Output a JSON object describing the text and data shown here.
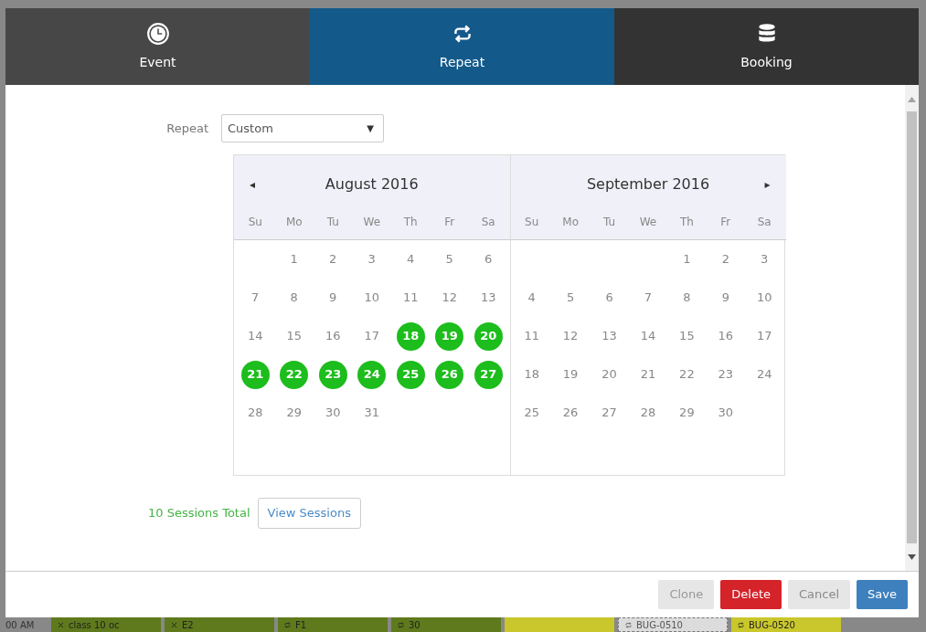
{
  "tabs": [
    {
      "label": "Event",
      "selected": false
    },
    {
      "label": "Repeat",
      "selected": true
    },
    {
      "label": "Booking",
      "selected": false
    }
  ],
  "repeat": {
    "label": "Repeat",
    "value": "Custom",
    "caret": "▼"
  },
  "calendar": {
    "prev": "◂",
    "next": "▸",
    "months": [
      {
        "title": "August 2016",
        "weekdays": [
          "Su",
          "Mo",
          "Tu",
          "We",
          "Th",
          "Fr",
          "Sa"
        ],
        "weeks": [
          [
            {
              "kind": "blank"
            },
            {
              "kind": "day",
              "day": "1",
              "selected": false
            },
            {
              "kind": "day",
              "day": "2",
              "selected": false
            },
            {
              "kind": "day",
              "day": "3",
              "selected": false
            },
            {
              "kind": "day",
              "day": "4",
              "selected": false
            },
            {
              "kind": "day",
              "day": "5",
              "selected": false
            },
            {
              "kind": "day",
              "day": "6",
              "selected": false
            }
          ],
          [
            {
              "kind": "day",
              "day": "7",
              "selected": false
            },
            {
              "kind": "day",
              "day": "8",
              "selected": false
            },
            {
              "kind": "day",
              "day": "9",
              "selected": false
            },
            {
              "kind": "day",
              "day": "10",
              "selected": false
            },
            {
              "kind": "day",
              "day": "11",
              "selected": false
            },
            {
              "kind": "day",
              "day": "12",
              "selected": false
            },
            {
              "kind": "day",
              "day": "13",
              "selected": false
            }
          ],
          [
            {
              "kind": "day",
              "day": "14",
              "selected": false
            },
            {
              "kind": "day",
              "day": "15",
              "selected": false
            },
            {
              "kind": "day",
              "day": "16",
              "selected": false
            },
            {
              "kind": "day",
              "day": "17",
              "selected": false
            },
            {
              "kind": "day",
              "day": "18",
              "selected": true
            },
            {
              "kind": "day",
              "day": "19",
              "selected": true
            },
            {
              "kind": "day",
              "day": "20",
              "selected": true
            }
          ],
          [
            {
              "kind": "day",
              "day": "21",
              "selected": true
            },
            {
              "kind": "day",
              "day": "22",
              "selected": true
            },
            {
              "kind": "day",
              "day": "23",
              "selected": true
            },
            {
              "kind": "day",
              "day": "24",
              "selected": true
            },
            {
              "kind": "day",
              "day": "25",
              "selected": true
            },
            {
              "kind": "day",
              "day": "26",
              "selected": true
            },
            {
              "kind": "day",
              "day": "27",
              "selected": true
            }
          ],
          [
            {
              "kind": "day",
              "day": "28",
              "selected": false
            },
            {
              "kind": "day",
              "day": "29",
              "selected": false
            },
            {
              "kind": "day",
              "day": "30",
              "selected": false
            },
            {
              "kind": "day",
              "day": "31",
              "selected": false
            },
            {
              "kind": "blank"
            },
            {
              "kind": "blank"
            },
            {
              "kind": "blank"
            }
          ]
        ]
      },
      {
        "title": "September 2016",
        "weekdays": [
          "Su",
          "Mo",
          "Tu",
          "We",
          "Th",
          "Fr",
          "Sa"
        ],
        "weeks": [
          [
            {
              "kind": "blank"
            },
            {
              "kind": "blank"
            },
            {
              "kind": "blank"
            },
            {
              "kind": "blank"
            },
            {
              "kind": "day",
              "day": "1",
              "selected": false
            },
            {
              "kind": "day",
              "day": "2",
              "selected": false
            },
            {
              "kind": "day",
              "day": "3",
              "selected": false
            }
          ],
          [
            {
              "kind": "day",
              "day": "4",
              "selected": false
            },
            {
              "kind": "day",
              "day": "5",
              "selected": false
            },
            {
              "kind": "day",
              "day": "6",
              "selected": false
            },
            {
              "kind": "day",
              "day": "7",
              "selected": false
            },
            {
              "kind": "day",
              "day": "8",
              "selected": false
            },
            {
              "kind": "day",
              "day": "9",
              "selected": false
            },
            {
              "kind": "day",
              "day": "10",
              "selected": false
            }
          ],
          [
            {
              "kind": "day",
              "day": "11",
              "selected": false
            },
            {
              "kind": "day",
              "day": "12",
              "selected": false
            },
            {
              "kind": "day",
              "day": "13",
              "selected": false
            },
            {
              "kind": "day",
              "day": "14",
              "selected": false
            },
            {
              "kind": "day",
              "day": "15",
              "selected": false
            },
            {
              "kind": "day",
              "day": "16",
              "selected": false
            },
            {
              "kind": "day",
              "day": "17",
              "selected": false
            }
          ],
          [
            {
              "kind": "day",
              "day": "18",
              "selected": false
            },
            {
              "kind": "day",
              "day": "19",
              "selected": false
            },
            {
              "kind": "day",
              "day": "20",
              "selected": false
            },
            {
              "kind": "day",
              "day": "21",
              "selected": false
            },
            {
              "kind": "day",
              "day": "22",
              "selected": false
            },
            {
              "kind": "day",
              "day": "23",
              "selected": false
            },
            {
              "kind": "day",
              "day": "24",
              "selected": false
            }
          ],
          [
            {
              "kind": "day",
              "day": "25",
              "selected": false
            },
            {
              "kind": "day",
              "day": "26",
              "selected": false
            },
            {
              "kind": "day",
              "day": "27",
              "selected": false
            },
            {
              "kind": "day",
              "day": "28",
              "selected": false
            },
            {
              "kind": "day",
              "day": "29",
              "selected": false
            },
            {
              "kind": "day",
              "day": "30",
              "selected": false
            },
            {
              "kind": "blank"
            }
          ]
        ]
      }
    ]
  },
  "sessions": {
    "total": "10 Sessions Total",
    "button": "View Sessions"
  },
  "footer_buttons": [
    {
      "label": "Clone",
      "kind": "disabled"
    },
    {
      "label": "Delete",
      "kind": "danger"
    },
    {
      "label": "Cancel",
      "kind": "secondary"
    },
    {
      "label": "Save",
      "kind": "primary"
    }
  ],
  "background": {
    "time": "00 AM",
    "events": [
      {
        "kind": "single",
        "text": "class 10 oc",
        "color": "#5e7a1c"
      },
      {
        "kind": "single",
        "text": "E2",
        "color": "#5e7a1c"
      },
      {
        "kind": "recurring",
        "text": "F1",
        "color": "#5e7a1c"
      },
      {
        "kind": "recurring",
        "text": "30",
        "color": "#5e7a1c"
      },
      {
        "kind": "block",
        "color": "#c9c72c"
      },
      {
        "kind": "recurring",
        "text": "BUG-0510",
        "cancelled": true,
        "color": "#dcdcdc"
      },
      {
        "kind": "recurring",
        "text": "BUG-0520",
        "color": "#c9c72c"
      }
    ]
  }
}
